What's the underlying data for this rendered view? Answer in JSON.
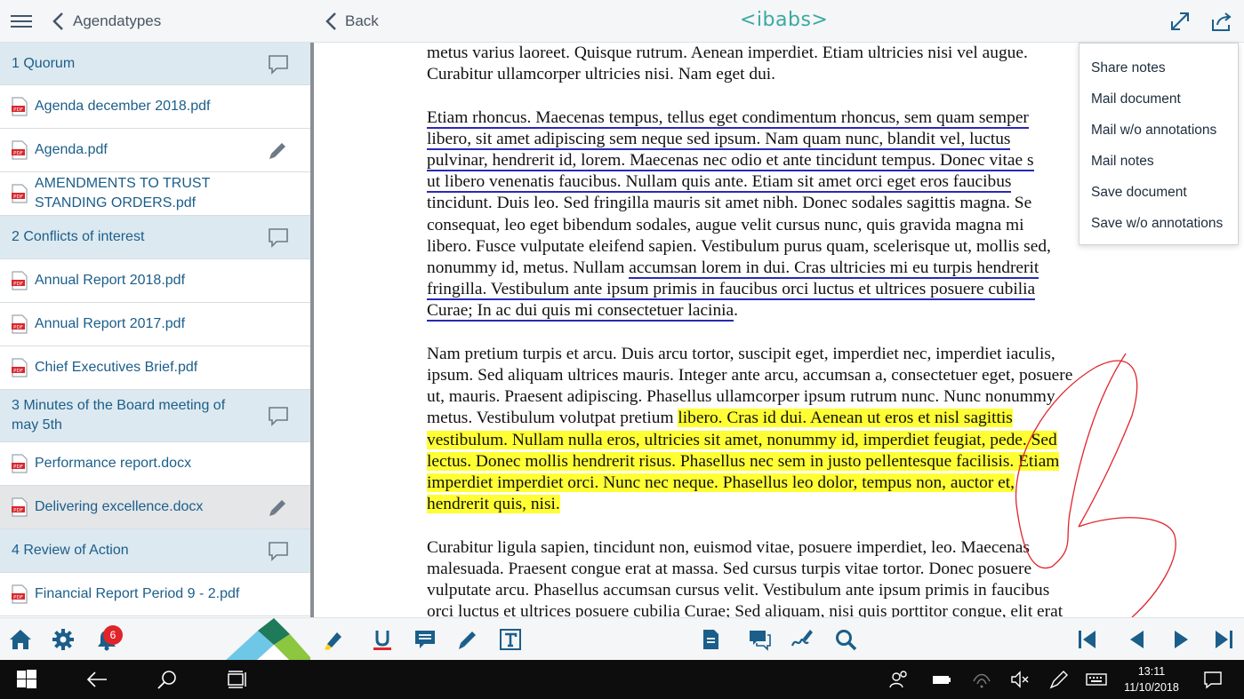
{
  "left_header": {
    "back_label": "Agendatypes"
  },
  "agenda": [
    {
      "type": "section",
      "label": "1 Quorum",
      "icon": "comment-icon"
    },
    {
      "type": "doc",
      "label": "Agenda december 2018.pdf",
      "icon": "pdf-icon"
    },
    {
      "type": "doc",
      "label": "Agenda.pdf",
      "icon": "pdf-icon",
      "right_icon": "pencil-icon"
    },
    {
      "type": "doc",
      "label": "AMENDMENTS TO TRUST STANDING ORDERS.pdf",
      "icon": "pdf-icon"
    },
    {
      "type": "section",
      "label": "2 Conflicts of interest",
      "icon": "comment-icon"
    },
    {
      "type": "doc",
      "label": "Annual Report 2018.pdf",
      "icon": "pdf-icon"
    },
    {
      "type": "doc",
      "label": "Annual Report 2017.pdf",
      "icon": "pdf-icon"
    },
    {
      "type": "doc",
      "label": "Chief Executives Brief.pdf",
      "icon": "pdf-icon"
    },
    {
      "type": "section",
      "label": "3 Minutes of the Board meeting of may 5th",
      "icon": "comment-icon"
    },
    {
      "type": "doc",
      "label": "Performance report.docx",
      "icon": "pdf-icon"
    },
    {
      "type": "doc",
      "label": "Delivering excellence.docx",
      "icon": "pdf-icon",
      "right_icon": "pencil-icon",
      "selected": true
    },
    {
      "type": "section",
      "label": "4 Review of Action",
      "icon": "comment-icon"
    },
    {
      "type": "doc",
      "label": "Financial Report Period 9 - 2.pdf",
      "icon": "pdf-icon"
    }
  ],
  "left_footer": {
    "notification_count": "6",
    "icons": [
      "home-icon",
      "gear-icon",
      "bell-icon"
    ]
  },
  "right_header": {
    "back_label": "Back",
    "logo": "<ibabs>",
    "icons": [
      "expand-icon",
      "share-icon"
    ]
  },
  "share_menu": [
    "Share notes",
    "Mail document",
    "Mail w/o annotations",
    "Mail notes",
    "Save document",
    "Save w/o annotations"
  ],
  "document": {
    "paragraphs": [
      [
        [
          {
            "t": "metus varius laoreet. Quisque rutrum. Aenean imperdiet. Etiam ultricies nisi vel augue."
          }
        ],
        [
          {
            "t": "Curabitur ullamcorper ultricies nisi. Nam eget dui."
          }
        ]
      ],
      [
        [
          {
            "t": "Etiam rhoncus. Maecenas tempus, tellus eget condimentum rhoncus, sem quam semper",
            "s": "u"
          }
        ],
        [
          {
            "t": "libero, sit amet adipiscing sem neque sed ipsum. Nam quam nunc, blandit vel, luctus",
            "s": "u"
          }
        ],
        [
          {
            "t": "pulvinar, hendrerit id, lorem. Maecenas nec odio et ante tincidunt tempus. Donec vitae s",
            "s": "u"
          }
        ],
        [
          {
            "t": "ut libero venenatis faucibus. Nullam quis ante. Etiam sit amet orci eget eros faucibus",
            "s": "u"
          }
        ],
        [
          {
            "t": "tincidunt. Duis leo. Sed fringilla mauris sit amet nibh. Donec sodales sagittis magna. Se"
          }
        ],
        [
          {
            "t": "consequat, leo eget bibendum sodales, augue velit cursus nunc, quis gravida magna mi"
          }
        ],
        [
          {
            "t": "libero. Fusce vulputate eleifend sapien. Vestibulum purus quam, scelerisque ut, mollis sed,"
          }
        ],
        [
          {
            "t": "nonummy id, metus. Nullam "
          },
          {
            "t": "accumsan lorem in dui. Cras ultricies mi eu turpis hendrerit",
            "s": "u"
          }
        ],
        [
          {
            "t": "fringilla. Vestibulum ante ipsum primis in faucibus orci luctus et ultrices posuere cubilia",
            "s": "u"
          }
        ],
        [
          {
            "t": "Curae; In ac dui quis mi consectetuer lacinia",
            "s": "u"
          },
          {
            "t": "."
          }
        ]
      ],
      [
        [
          {
            "t": "Nam pretium turpis et arcu. Duis arcu tortor, suscipit eget, imperdiet nec, imperdiet iaculis,"
          }
        ],
        [
          {
            "t": "ipsum. Sed aliquam ultrices mauris. Integer ante arcu, accumsan a, consectetuer eget, posuere"
          }
        ],
        [
          {
            "t": "ut, mauris. Praesent adipiscing. Phasellus ullamcorper ipsum rutrum nunc. Nunc nonummy"
          }
        ],
        [
          {
            "t": "metus. Vestibulum volutpat pretium "
          },
          {
            "t": "libero. Cras id dui. Aenean ut eros et nisl sagittis",
            "s": "h"
          }
        ],
        [
          {
            "t": "vestibulum. Nullam nulla eros, ultricies sit amet, nonummy id, imperdiet feugiat, pede. Sed",
            "s": "h"
          }
        ],
        [
          {
            "t": "lectus. Donec mollis hendrerit risus. Phasellus nec sem in justo pellentesque facilisis. Etiam",
            "s": "h"
          }
        ],
        [
          {
            "t": "imperdiet imperdiet orci. Nunc nec neque. Phasellus leo dolor, tempus non, auctor et,",
            "s": "h"
          }
        ],
        [
          {
            "t": "hendrerit quis, nisi.",
            "s": "h"
          }
        ]
      ],
      [
        [
          {
            "t": "Curabitur ligula sapien, tincidunt non, euismod vitae, posuere imperdiet, leo. Maecenas"
          }
        ],
        [
          {
            "t": "malesuada. Praesent congue erat at massa. Sed cursus turpis vitae tortor. Donec posuere"
          }
        ],
        [
          {
            "t": "vulputate arcu. Phasellus accumsan cursus velit. Vestibulum ante ipsum primis in faucibus"
          }
        ],
        [
          {
            "t": "orci luctus et ultrices posuere cubilia Curae; Sed aliquam, nisi quis porttitor congue, elit erat"
          }
        ]
      ]
    ]
  },
  "toolbar_icons": [
    "highlighter-icon",
    "underline-icon",
    "comment-add-icon",
    "pen-icon",
    "text-icon",
    "note-list-icon",
    "comments-icon",
    "signature-icon",
    "search-icon",
    "first-page-icon",
    "previous-page-icon",
    "next-page-icon",
    "last-page-icon"
  ],
  "taskbar": {
    "time": "13:11",
    "date": "11/10/2018"
  },
  "colors": {
    "accent": "#1b5e8a",
    "section_bg": "#dde9f0",
    "highlight": "#ffff33",
    "underline": "#2a2ab5",
    "ink": "#e0262d",
    "logo": "#3aa9a3"
  }
}
